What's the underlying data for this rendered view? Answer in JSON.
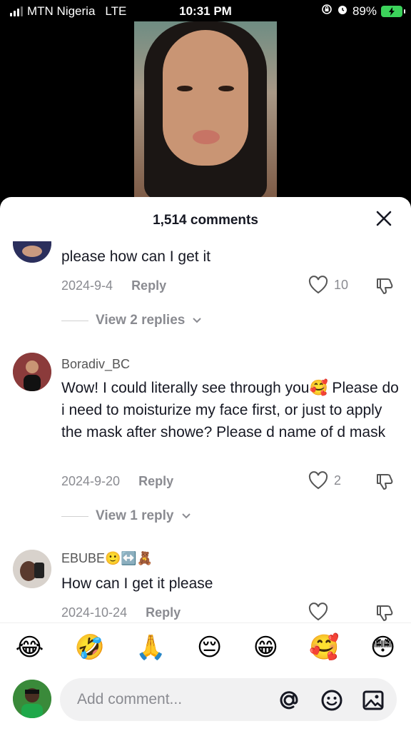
{
  "status_bar": {
    "carrier": "MTN Nigeria",
    "network": "LTE",
    "time": "10:31 PM",
    "battery": "89%"
  },
  "panel": {
    "title": "1,514 comments"
  },
  "comments": [
    {
      "username": "",
      "text": "please how can I get it",
      "date": "2024-9-4",
      "reply_label": "Reply",
      "likes": "10",
      "view_replies": "View 2 replies"
    },
    {
      "username": "Boradiv_BC",
      "text": "Wow! I could literally see through you🥰 Please do i need to moisturize my face first, or just to apply the mask after showe? Please d name of d mask",
      "date": "2024-9-20",
      "reply_label": "Reply",
      "likes": "2",
      "view_replies": "View 1 reply"
    },
    {
      "username": "EBUBE🙂↔️🧸",
      "text": "How can I get it please",
      "date": "2024-10-24",
      "reply_label": "Reply",
      "likes": ""
    }
  ],
  "emoji_bar": [
    "😂",
    "🤣",
    "🙏",
    "😔",
    "😁",
    "🥰",
    "😳"
  ],
  "input": {
    "placeholder": "Add comment..."
  },
  "colors": {
    "accent_battery": "#3cd35b",
    "muted_text": "#8a8b91",
    "primary_text": "#161823"
  }
}
